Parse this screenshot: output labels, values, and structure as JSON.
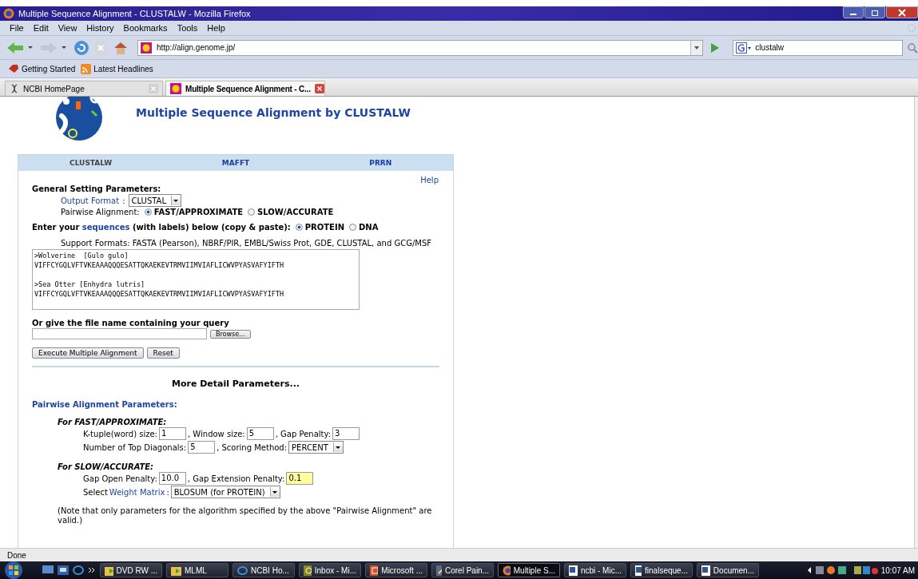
{
  "window": {
    "title": "Multiple Sequence Alignment - CLUSTALW - Mozilla Firefox"
  },
  "menu": [
    "File",
    "Edit",
    "View",
    "History",
    "Bookmarks",
    "Tools",
    "Help"
  ],
  "address": {
    "url": "http://align.genome.jp/"
  },
  "search": {
    "value": "clustalw"
  },
  "bookmarks": [
    "Getting Started",
    "Latest Headlines"
  ],
  "tabs": [
    {
      "label": "NCBI HomePage",
      "selected": false
    },
    {
      "label": "Multiple Sequence Alignment - C...",
      "selected": true
    }
  ],
  "page": {
    "heading": "Multiple Sequence Alignment by CLUSTALW",
    "nav": [
      {
        "label": "CLUSTALW",
        "selected": true
      },
      {
        "label": "MAFFT",
        "selected": false
      },
      {
        "label": "PRRN",
        "selected": false
      }
    ],
    "help": "Help",
    "general_title": "General Setting Parameters:",
    "output_format": {
      "link": "Output Format",
      "suffix": ":",
      "value": "CLUSTAL"
    },
    "pairwise": {
      "label": "Pairwise Alignment:",
      "options": [
        {
          "label": "FAST/APPROXIMATE",
          "selected": true
        },
        {
          "label": "SLOW/ACCURATE",
          "selected": false
        }
      ]
    },
    "sequence_prompt": {
      "before": "Enter your",
      "link": "sequences",
      "after": "(with labels) below (copy & paste):",
      "options": [
        {
          "label": "PROTEIN",
          "selected": true
        },
        {
          "label": "DNA",
          "selected": false
        }
      ]
    },
    "support_formats": "Support Formats: FASTA (Pearson), NBRF/PIR, EMBL/Swiss Prot, GDE, CLUSTAL, and GCG/MSF",
    "sequences": ">Wolverine  [Gulo gulo]\nVIFFCYGQLVFTVKEAAAQQQESATTQKAEKEVTRMVIIMVIAFLICWVPYASVAFYIFTH\n\n>Sea Otter [Enhydra lutris]\nVIFFCYGQLVFTVKEAAAQQQESATTQKAEKEVTRMVIIMVIAFLICWVPYASVAFYIFTH",
    "file_prompt": "Or give the file name containing your query",
    "browse": "Browse...",
    "buttons": [
      "Execute Multiple Alignment",
      "Reset"
    ],
    "more_heading": "More Detail Parameters...",
    "params_title": "Pairwise Alignment Parameters:",
    "groups": [
      {
        "title": "For FAST/APPROXIMATE:",
        "rows": [
          [
            {
              "kind": "input",
              "label": "K-tuple(word) size:",
              "value": "1",
              "highlighted": false
            },
            {
              "kind": "input",
              "label": ", Window size:",
              "value": "5",
              "highlighted": false
            },
            {
              "kind": "input",
              "label": ", Gap Penalty:",
              "value": "3",
              "highlighted": false
            }
          ],
          [
            {
              "kind": "input",
              "label": "Number of Top Diagonals:",
              "value": "5",
              "highlighted": false
            },
            {
              "kind": "select",
              "label": ", Scoring Method:",
              "value": "PERCENT"
            }
          ]
        ]
      },
      {
        "title": "For SLOW/ACCURATE:",
        "rows": [
          [
            {
              "kind": "input",
              "label": "Gap Open Penalty:",
              "value": "10.0",
              "highlighted": false
            },
            {
              "kind": "input",
              "label": ", Gap Extension Penalty:",
              "value": "0.1",
              "highlighted": true
            }
          ],
          [
            {
              "kind": "select",
              "label": "Select",
              "link": "Weight Matrix",
              "suffix": ":",
              "value": "BLOSUM (for PROTEIN)"
            }
          ]
        ]
      }
    ],
    "note": "(Note that only parameters for the algorithm specified by the above \"Pairwise Alignment\" are valid.)"
  },
  "status_bar": "Done",
  "taskbar": {
    "items": [
      {
        "kind": "folder",
        "label": "DVD RW ...",
        "selected": false
      },
      {
        "kind": "folder",
        "label": "MLML",
        "selected": false
      },
      {
        "kind": "ie",
        "label": "NCBI Ho...",
        "selected": false
      },
      {
        "kind": "mail",
        "label": "Inbox - Mi...",
        "selected": false
      },
      {
        "kind": "slides",
        "label": "Microsoft ...",
        "selected": false
      },
      {
        "kind": "paint",
        "label": "Corel Pain...",
        "selected": false
      },
      {
        "kind": "firefox",
        "label": "Multiple S...",
        "selected": true
      },
      {
        "kind": "word",
        "label": "ncbi - Mic...",
        "selected": false
      },
      {
        "kind": "word",
        "label": "finalseque...",
        "selected": false
      },
      {
        "kind": "word",
        "label": "Documen...",
        "selected": false
      }
    ],
    "clock": "10:07 AM"
  }
}
